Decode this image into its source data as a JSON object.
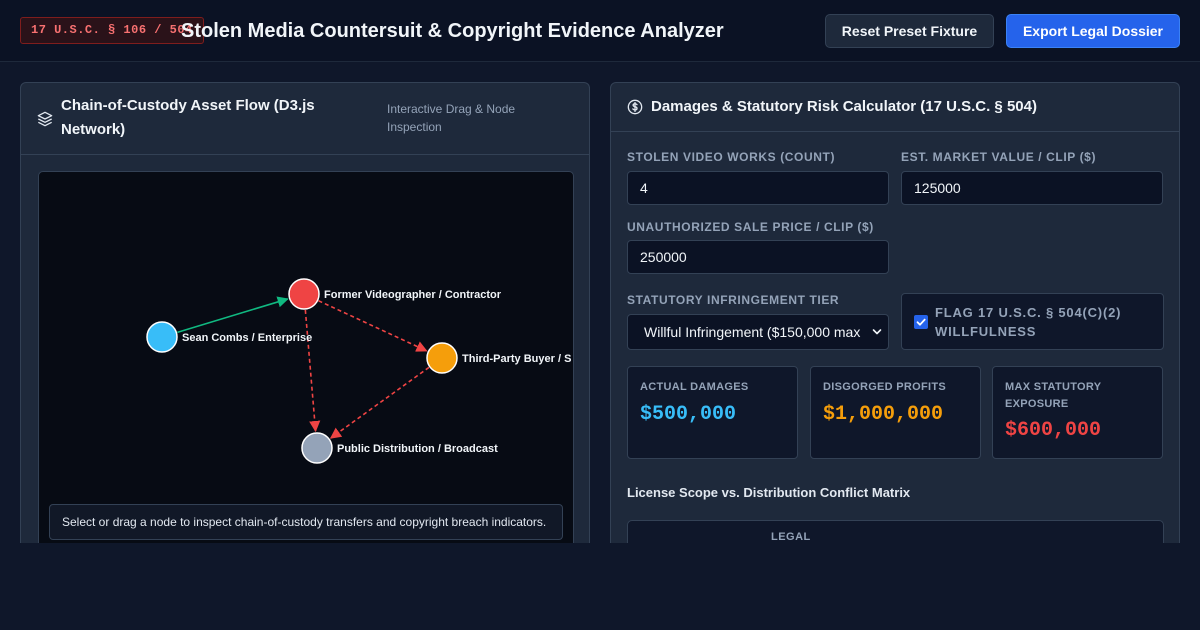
{
  "header": {
    "badge": "17 U.S.C. § 106 / 504",
    "title": "Stolen Media Countersuit & Copyright Evidence Analyzer",
    "reset_label": "Reset Preset Fixture",
    "export_label": "Export Legal Dossier"
  },
  "left_panel": {
    "icon": "layers-icon",
    "title_line1": "Chain-of-Custody Asset Flow (D3.js",
    "title_line2": "Network)",
    "subtitle_line1": "Interactive Drag & Node",
    "subtitle_line2": "Inspection",
    "nodes": [
      {
        "id": "combs",
        "label": "Sean Combs / Enterprise",
        "color": "#38bdf8"
      },
      {
        "id": "videographer",
        "label": "Former Videographer / Contractor",
        "color": "#ef4444"
      },
      {
        "id": "buyer",
        "label": "Third-Party Buyer / S",
        "color": "#f59e0b"
      },
      {
        "id": "public",
        "label": "Public Distribution / Broadcast",
        "color": "#94a3b8"
      }
    ],
    "edges": [
      {
        "from": "combs",
        "to": "videographer",
        "style": "solid",
        "color": "#10b981"
      },
      {
        "from": "videographer",
        "to": "buyer",
        "style": "dashed",
        "color": "#ef4444"
      },
      {
        "from": "videographer",
        "to": "public",
        "style": "dashed",
        "color": "#ef4444"
      },
      {
        "from": "buyer",
        "to": "public",
        "style": "dashed",
        "color": "#ef4444"
      }
    ],
    "info_text": "Select or drag a node to inspect chain-of-custody transfers and copyright breach indicators."
  },
  "right_panel": {
    "icon": "dollar-circle-icon",
    "title": "Damages & Statutory Risk Calculator (17 U.S.C. § 504)",
    "fields": {
      "works_label": "STOLEN VIDEO WORKS (COUNT)",
      "works_value": "4",
      "market_label": "EST. MARKET VALUE / CLIP ($)",
      "market_value": "125000",
      "sale_label": "UNAUTHORIZED SALE PRICE / CLIP ($)",
      "sale_value": "250000",
      "tier_label": "STATUTORY INFRINGEMENT TIER",
      "tier_value": "Willful Infringement ($150,000 max",
      "flag_line1": "FLAG 17 U.S.C. § 504(C)(2)",
      "flag_line2": "WILLFULNESS",
      "flag_checked": true
    },
    "stats": [
      {
        "label": "ACTUAL DAMAGES",
        "value": "$500,000",
        "color": "#38bdf8"
      },
      {
        "label": "DISGORGED PROFITS",
        "value": "$1,000,000",
        "color": "#f59e0b"
      },
      {
        "label_line1": "MAX STATUTORY",
        "label_line2": "EXPOSURE",
        "value": "$600,000",
        "color": "#ef4444"
      }
    ],
    "matrix_title": "License Scope vs. Distribution Conflict Matrix",
    "matrix_header": "LEGAL"
  }
}
